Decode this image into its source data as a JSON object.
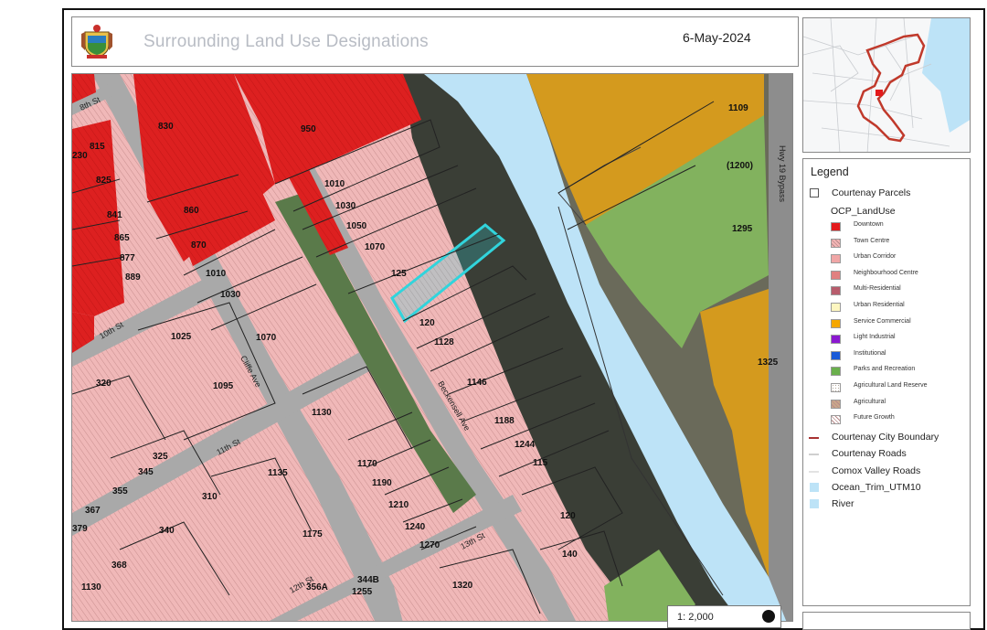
{
  "header": {
    "title": "Surrounding Land Use Designations",
    "date": "6-May-2024"
  },
  "map": {
    "street_labels": {
      "st_8th": "8th St",
      "st_10th": "10th St",
      "st_11th": "11th St",
      "st_12th": "12th St",
      "st_13th": "13th St",
      "ave_cliffe": "Cliffe Ave",
      "ave_beckensell": "Beckensell Ave",
      "hwy_bypass": "Hwy 19 Bypass"
    },
    "parcel_numbers": {
      "p830": "830",
      "p815": "815",
      "p230": "230",
      "p825": "825",
      "p841": "841",
      "p865": "865",
      "p877": "877",
      "p889": "889",
      "p860": "860",
      "p870": "870",
      "p950": "950",
      "p1010a": "1010",
      "p1030a": "1030",
      "p1050": "1050",
      "p1070a": "1070",
      "p125": "125",
      "p1010b": "1010",
      "p1030b": "1030",
      "p1025": "1025",
      "p1070b": "1070",
      "p320": "320",
      "p1095": "1095",
      "p120a": "120",
      "p1128": "1128",
      "p1146": "1146",
      "p1188": "1188",
      "p1244": "1244",
      "p115": "115",
      "p1130a": "1130",
      "p325": "325",
      "p345": "345",
      "p355": "355",
      "p1135": "1135",
      "p1170": "1170",
      "p1190": "1190",
      "p1210": "1210",
      "p310": "310",
      "p367": "367",
      "p379": "379",
      "p340": "340",
      "p1240": "1240",
      "p1270": "1270",
      "p1175": "1175",
      "p368": "368",
      "p1130b": "1130",
      "p356A": "356A",
      "p344B": "344B",
      "p1255": "1255",
      "p1320": "1320",
      "p120b": "120",
      "p140": "140",
      "p1109": "1109",
      "p1200": "(1200)",
      "p1295": "1295",
      "p1325": "1325"
    },
    "scale": "1: 2,000",
    "colors": {
      "downtown": "#e31a1c",
      "town_centre": "#f2b8b8",
      "river": "#bde3f7",
      "service_commercial": "#f0a81a",
      "parks": "#7cbc5a",
      "subject_parcel": "#31d4dc",
      "boundary": "#c0392b"
    }
  },
  "legend": {
    "title": "Legend",
    "parcels_label": "Courtenay Parcels",
    "group_label": "OCP_LandUse",
    "categories": [
      {
        "label": "Downtown",
        "color": "#e31a1c",
        "pattern": "solid"
      },
      {
        "label": "Town Centre",
        "color": "#f4b6b6",
        "pattern": "hatch"
      },
      {
        "label": "Urban Corridor",
        "color": "#f0a6a6",
        "pattern": "solid"
      },
      {
        "label": "Neighbourhood Centre",
        "color": "#e08080",
        "pattern": "solid"
      },
      {
        "label": "Multi-Residential",
        "color": "#b85c6c",
        "pattern": "solid"
      },
      {
        "label": "Urban Residential",
        "color": "#fdf6c0",
        "pattern": "solid"
      },
      {
        "label": "Service Commercial",
        "color": "#f5a700",
        "pattern": "solid"
      },
      {
        "label": "Light Industrial",
        "color": "#8b18d0",
        "pattern": "solid"
      },
      {
        "label": "Institutional",
        "color": "#1a5ad8",
        "pattern": "solid"
      },
      {
        "label": "Parks and Recreation",
        "color": "#6ab04c",
        "pattern": "solid"
      },
      {
        "label": "Agricultural Land Reserve",
        "color": "#ffffff",
        "pattern": "dots"
      },
      {
        "label": "Agricultural",
        "color": "#c9a88a",
        "pattern": "hatch"
      },
      {
        "label": "Future Growth",
        "color": "#ffffff",
        "pattern": "hatch"
      }
    ],
    "lines": [
      {
        "label": "Courtenay City Boundary",
        "color": "#a83232",
        "kind": "line"
      },
      {
        "label": "Courtenay Roads",
        "color": "#cfcfcf",
        "kind": "line"
      },
      {
        "label": "Comox Valley Roads",
        "color": "#e3e3e3",
        "kind": "line"
      },
      {
        "label": "Ocean_Trim_UTM10",
        "color": "#bde3f7",
        "kind": "box"
      },
      {
        "label": "River",
        "color": "#bde3f7",
        "kind": "box"
      }
    ]
  }
}
